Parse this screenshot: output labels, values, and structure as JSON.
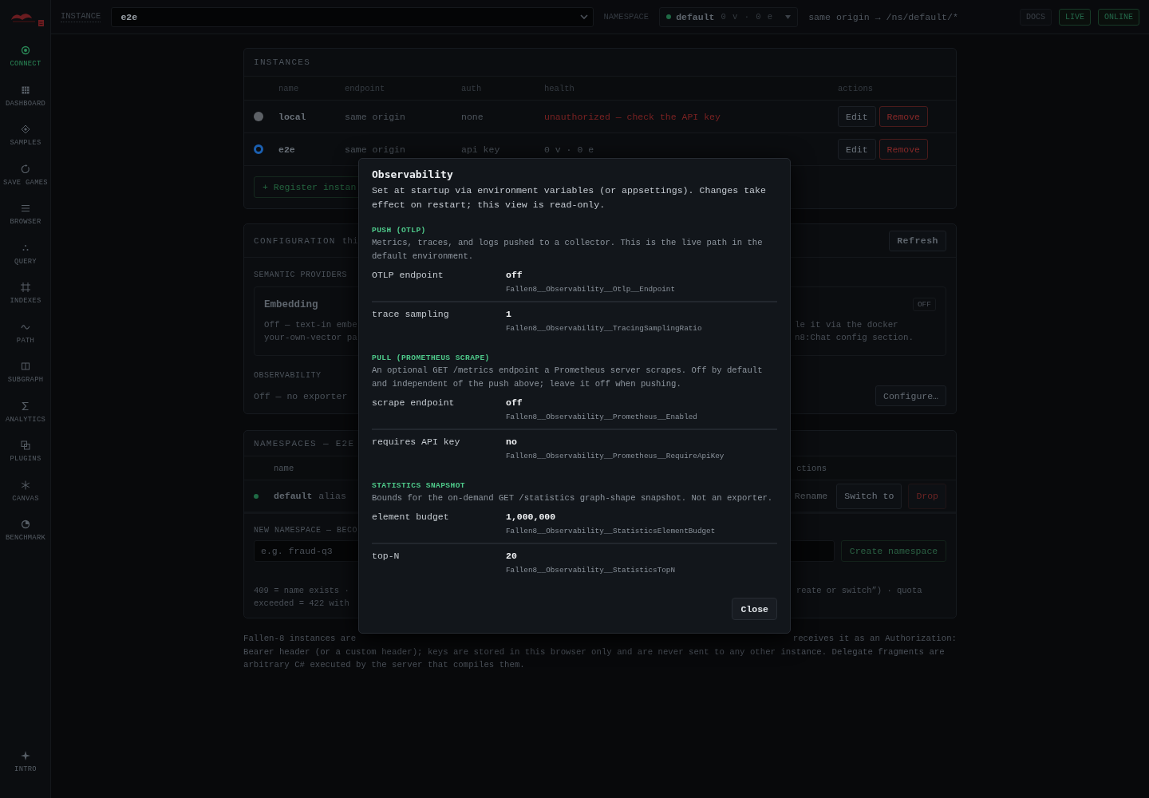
{
  "sidebar": {
    "items": [
      {
        "label": "CONNECT",
        "selected": true
      },
      {
        "label": "DASHBOARD",
        "selected": false
      },
      {
        "label": "SAMPLES",
        "selected": false
      },
      {
        "label": "SAVE GAMES",
        "selected": false
      },
      {
        "label": "BROWSER",
        "selected": false
      },
      {
        "label": "QUERY",
        "selected": false
      },
      {
        "label": "INDEXES",
        "selected": false
      },
      {
        "label": "PATH",
        "selected": false
      },
      {
        "label": "SUBGRAPH",
        "selected": false
      },
      {
        "label": "ANALYTICS",
        "selected": false
      },
      {
        "label": "PLUGINS",
        "selected": false
      },
      {
        "label": "CANVAS",
        "selected": false
      },
      {
        "label": "BENCHMARK",
        "selected": false
      }
    ],
    "footer_item": {
      "label": "INTRO"
    }
  },
  "topbar": {
    "instance_label": "INSTANCE",
    "instance_select": {
      "value": "e2e"
    },
    "namespace_label": "NAMESPACE",
    "namespace_select": {
      "name": "default",
      "counts": "0 v · 0 e"
    },
    "route": "same origin → /ns/default/*",
    "buttons": [
      {
        "label": "DOCS",
        "kind": "neutral"
      },
      {
        "label": "LIVE",
        "kind": "success"
      },
      {
        "label": "ONLINE",
        "kind": "success"
      }
    ]
  },
  "instances": {
    "title": "INSTANCES",
    "columns": [
      "name",
      "endpoint",
      "auth",
      "health",
      "actions"
    ],
    "rows": [
      {
        "selected": false,
        "name": "local",
        "endpoint": "same origin",
        "auth": "none",
        "health": "unauthorized — check the API key",
        "error": true,
        "actions": [
          {
            "label": "Edit",
            "kind": "neutral",
            "disabled": false
          },
          {
            "label": "Remove",
            "kind": "danger",
            "disabled": false
          }
        ]
      },
      {
        "selected": true,
        "name": "e2e",
        "endpoint": "same origin",
        "auth": "api key",
        "health": "0 v · 0 e",
        "error": false,
        "actions": [
          {
            "label": "Edit",
            "kind": "neutral",
            "disabled": false
          },
          {
            "label": "Remove",
            "kind": "danger",
            "disabled": false
          }
        ]
      }
    ],
    "register_button": "+ Register instan"
  },
  "configuration": {
    "title": "CONFIGURATION",
    "subtitle": "thi",
    "refresh_button": "Refresh",
    "semantic_label": "SEMANTIC PROVIDERS",
    "provider": {
      "name": "Embedding",
      "description_left": [
        "Off — text-in embe",
        "your-own-vector pa"
      ],
      "status": "OFF",
      "description_right": [
        "le it via the docker",
        "n8:Chat config section."
      ]
    },
    "observability_label": "OBSERVABILITY",
    "observability_status": "Off — no exporter",
    "configure_button": "Configure…"
  },
  "namespaces": {
    "title": "NAMESPACES — E2E",
    "column_left": "name",
    "column_right": "ctions",
    "rows": [
      {
        "name": "default",
        "note": "alias",
        "actions": [
          {
            "label": "Rename",
            "kind": "neutral",
            "disabled": true
          },
          {
            "label": "Switch to",
            "kind": "neutral",
            "disabled": false
          },
          {
            "label": "Drop",
            "kind": "danger",
            "disabled": true
          }
        ]
      }
    ],
    "new_namespace": {
      "label": "NEW NAMESPACE — BECO",
      "input": {
        "placeholder": "e.g. fraud-q3"
      },
      "create_button": {
        "label": "Create namespace",
        "disabled": true
      },
      "note_left": [
        "409 = name exists ·",
        "exceeded = 422 with"
      ],
      "note_right": "reate or switch”) · quota"
    }
  },
  "footer_note": {
    "line1_left": "Fallen-8 instances are",
    "line1_right": "receives it as an Authorization:",
    "rest": "Bearer header (or a custom header); keys are stored in this browser only and are never sent to any other instance. Delegate fragments are arbitrary C# executed by the server that compiles them."
  },
  "modal": {
    "title": "Observability",
    "intro": "Set at startup via environment variables (or appsettings). Changes take effect on restart; this view is read-only.",
    "sections": [
      {
        "heading": "PUSH (OTLP)",
        "description": "Metrics, traces, and logs pushed to a collector. This is the live path in the default environment.",
        "settings": [
          {
            "name": "OTLP endpoint",
            "value": "off",
            "env_var": "Fallen8__Observability__Otlp__Endpoint"
          },
          {
            "name": "trace sampling",
            "value": "1",
            "env_var": "Fallen8__Observability__TracingSamplingRatio"
          }
        ]
      },
      {
        "heading": "PULL (PROMETHEUS SCRAPE)",
        "description": "An optional GET /metrics endpoint a Prometheus server scrapes. Off by default and independent of the push above; leave it off when pushing.",
        "settings": [
          {
            "name": "scrape endpoint",
            "value": "off",
            "env_var": "Fallen8__Observability__Prometheus__Enabled"
          },
          {
            "name": "requires API key",
            "value": "no",
            "env_var": "Fallen8__Observability__Prometheus__RequireApiKey"
          }
        ]
      },
      {
        "heading": "STATISTICS SNAPSHOT",
        "description": "Bounds for the on-demand GET /statistics graph-shape snapshot. Not an exporter.",
        "settings": [
          {
            "name": "element budget",
            "value": "1,000,000",
            "env_var": "Fallen8__Observability__StatisticsElementBudget"
          },
          {
            "name": "top-N",
            "value": "20",
            "env_var": "Fallen8__Observability__StatisticsTopN"
          }
        ]
      }
    ],
    "close_button": "Close"
  }
}
